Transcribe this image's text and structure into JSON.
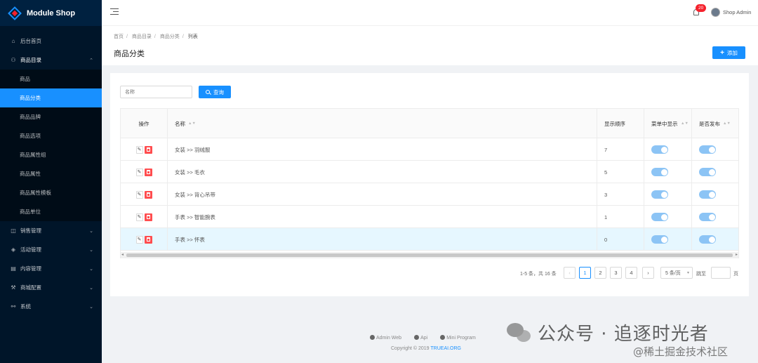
{
  "app": {
    "title": "Module Shop"
  },
  "sidebar": {
    "items": [
      {
        "label": "后台首页",
        "icon": "home-icon",
        "chevron": ""
      },
      {
        "label": "商品目录",
        "icon": "sitemap-icon",
        "chevron": "⌃"
      },
      {
        "label": "销售管理",
        "icon": "bag-icon",
        "chevron": "⌄"
      },
      {
        "label": "活动管理",
        "icon": "tag-icon",
        "chevron": "⌄"
      },
      {
        "label": "内容管理",
        "icon": "doc-icon",
        "chevron": "⌄"
      },
      {
        "label": "商城配置",
        "icon": "wrench-icon",
        "chevron": "⌄"
      },
      {
        "label": "系统",
        "icon": "cluster-icon",
        "chevron": "⌄"
      }
    ],
    "sub_items": [
      "商品",
      "商品分类",
      "商品品牌",
      "商品选项",
      "商品属性组",
      "商品属性",
      "商品属性模板",
      "商品单位"
    ],
    "active_sub": "商品分类"
  },
  "header": {
    "notification_count": "20",
    "user": "Shop Admin"
  },
  "breadcrumb": [
    "首页",
    "商品目录",
    "商品分类",
    "列表"
  ],
  "page": {
    "title": "商品分类",
    "add_label": "添加"
  },
  "search": {
    "placeholder": "名称",
    "button_label": "查询"
  },
  "table": {
    "columns": {
      "ops": "操作",
      "name": "名称",
      "order": "显示顺序",
      "menu": "菜单中显示",
      "publish": "是否发布"
    },
    "rows": [
      {
        "name": "女装 >> 羽绒服",
        "order": "7",
        "menu": true,
        "publish": true
      },
      {
        "name": "女装 >> 毛衣",
        "order": "5",
        "menu": true,
        "publish": true
      },
      {
        "name": "女装 >> 背心吊带",
        "order": "3",
        "menu": true,
        "publish": true
      },
      {
        "name": "手表 >> 智能腕表",
        "order": "1",
        "menu": true,
        "publish": true
      },
      {
        "name": "手表 >> 怀表",
        "order": "0",
        "menu": true,
        "publish": true
      }
    ]
  },
  "pagination": {
    "total_text": "1-5 条，共 16 条",
    "prev": "‹",
    "pages": [
      "1",
      "2",
      "3",
      "4"
    ],
    "next": "›",
    "current": "1",
    "page_size": "5 条/页",
    "jump_label": "跳至",
    "jump_suffix": "页"
  },
  "footer": {
    "links": [
      "Admin Web",
      "Api",
      "Mini Program"
    ],
    "copyright_prefix": "Copyright © 2019 ",
    "copyright_org": "TRUEAI.ORG"
  },
  "watermark": {
    "wechat": "公众号 · 追逐时光者",
    "juejin": "@稀土掘金技术社区"
  },
  "colors": {
    "primary": "#1890ff",
    "sidebar_bg": "#001529",
    "danger": "#ff4d4f"
  }
}
